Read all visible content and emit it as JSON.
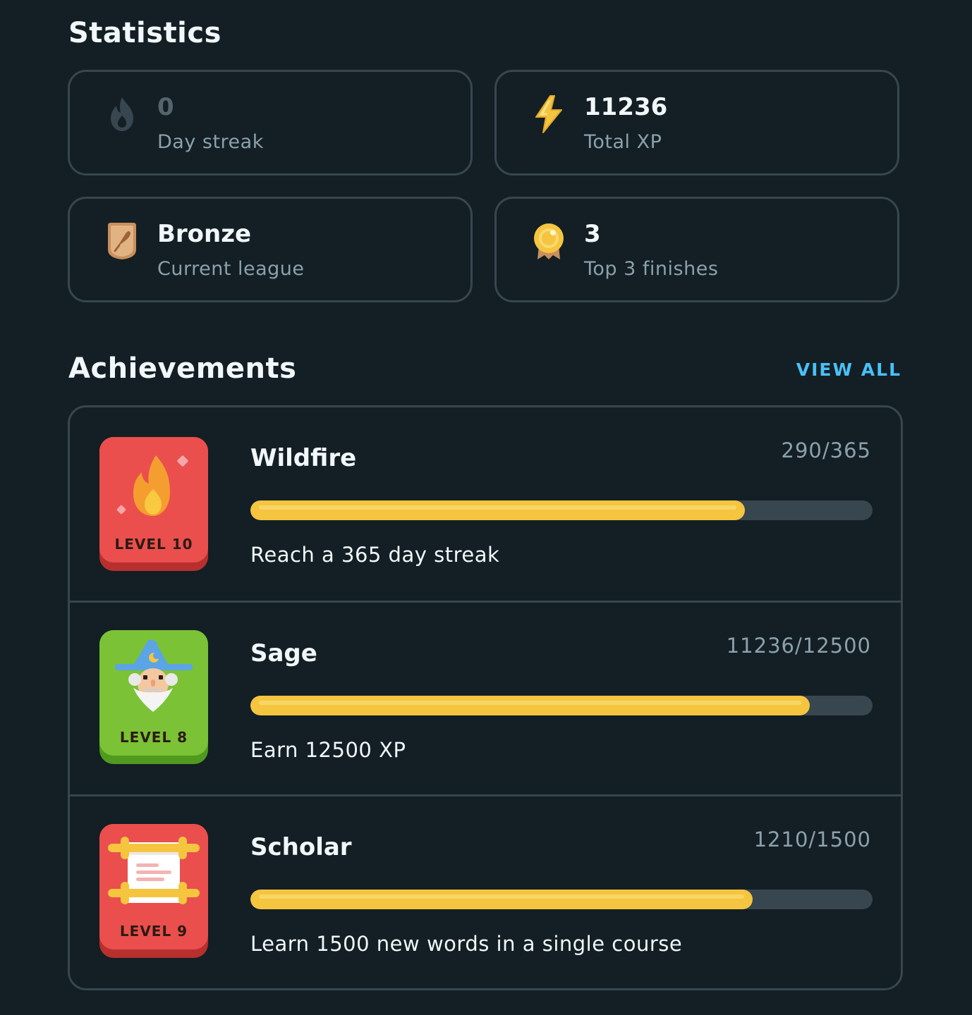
{
  "statistics": {
    "title": "Statistics",
    "cards": [
      {
        "icon": "flame-icon",
        "value": "0",
        "label": "Day streak"
      },
      {
        "icon": "lightning-bolt-icon",
        "value": "11236",
        "label": "Total XP"
      },
      {
        "icon": "bronze-league-shield-icon",
        "value": "Bronze",
        "label": "Current league"
      },
      {
        "icon": "gold-medal-icon",
        "value": "3",
        "label": "Top 3 finishes"
      }
    ]
  },
  "achievements": {
    "title": "Achievements",
    "view_all_label": "VIEW ALL",
    "items": [
      {
        "name": "Wildfire",
        "progress_text": "290/365",
        "progress": 0.7945,
        "description": "Reach a 365 day streak",
        "level": "LEVEL 10",
        "badge_icon": "flame-icon",
        "badge_color": "#ea4f4d"
      },
      {
        "name": "Sage",
        "progress_text": "11236/12500",
        "progress": 0.8989,
        "description": "Earn 12500 XP",
        "level": "LEVEL 8",
        "badge_icon": "wizard-icon",
        "badge_color": "#7bc236"
      },
      {
        "name": "Scholar",
        "progress_text": "1210/1500",
        "progress": 0.8067,
        "description": "Learn 1500 new words in a single course",
        "level": "LEVEL 9",
        "badge_icon": "scroll-icon",
        "badge_color": "#ea4f4d"
      }
    ]
  },
  "colors": {
    "background": "#131f24",
    "border": "#37464f",
    "link": "#49c0f8",
    "progress_fill": "#f5c540",
    "progress_track": "#37464f"
  }
}
